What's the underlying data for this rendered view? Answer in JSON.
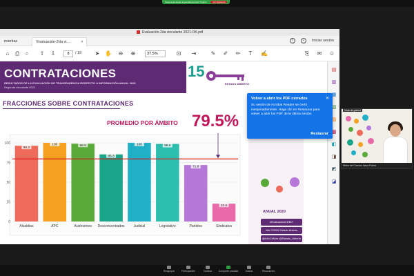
{
  "zoom": {
    "share_text": "Usted está viendo la pantalla de Kobi Trujano",
    "stop_label": "Ver Opciones",
    "bottom_items": [
      {
        "label": "Reagrupar",
        "icon": "audio-icon"
      },
      {
        "label": "Participantes",
        "icon": "participants-icon"
      },
      {
        "label": "Chatear",
        "icon": "chat-icon"
      },
      {
        "label": "Compartir pantalla",
        "icon": "share-screen-icon"
      },
      {
        "label": "Grabar",
        "icon": "record-icon"
      },
      {
        "label": "Reacciones",
        "icon": "reactions-icon"
      }
    ]
  },
  "acrobat": {
    "window_title": "Evaluación-2da vinculante 2021-OK.pdf",
    "tools_tab": "mientas",
    "doc_tab": "Evaluación-2da vi...",
    "sign_in": "Iniciar sesión",
    "page_current": "8",
    "page_total": "/ 18",
    "zoom_level": "37.5%"
  },
  "notification": {
    "title": "Volver a abrir los PDF cerrados",
    "body": "Su sesión de Acrobat Reader se cerró inesperadamente. Haga clic en Restaurar para volver a abrir los PDF de la última sesión.",
    "action": "Restaurar"
  },
  "slide": {
    "title": "CONTRATACIONES",
    "subtitle1": "RESULTADOS DE LA EVALUACIÓN DE TRANSPARENCIA RESPECTO A INFORMACIÓN ANUAL 2020",
    "subtitle2": "Segunda vinculante 2021",
    "logo_text": "15",
    "estado": "ESTADO ABIERTO",
    "section_title": "FRACCIONES SOBRE CONTRATACIONES",
    "promedio_label": "PROMEDIO POR ÁMBITO",
    "promedio_value": "79.5%",
    "anual": "ANUAL 2020",
    "tags": [
      "#EvaluaciónCDMX",
      "Info CDMX Estado Abierto",
      "@InfoCdMex @Estado_Abierto"
    ]
  },
  "chart_data": {
    "type": "bar",
    "categories": [
      "Alcaldías",
      "APC",
      "Autónomos",
      "Desconcentrados",
      "Judicial",
      "Legislativo",
      "Partidos",
      "Sindicatos"
    ],
    "values": [
      96.3,
      100,
      98.9,
      85.3,
      100,
      98.6,
      71.8,
      22.6
    ],
    "value_labels": [
      "96.3",
      "100",
      "98.9",
      "85.3",
      "100",
      "98.6",
      "71.8",
      "22.6"
    ],
    "colors": [
      "#ee6a5a",
      "#f4a020",
      "#5aaa3a",
      "#18a58a",
      "#1fb0c8",
      "#2cbfb0",
      "#b577d8",
      "#e86aa8"
    ],
    "reference_line": 79.5,
    "reference_color": "#d81b1b",
    "yticks": [
      0,
      25,
      50,
      75,
      100
    ],
    "ylim": [
      0,
      100
    ]
  },
  "video": {
    "tag": "Vista de galería",
    "name": "María del Carmen Nava Polina"
  }
}
